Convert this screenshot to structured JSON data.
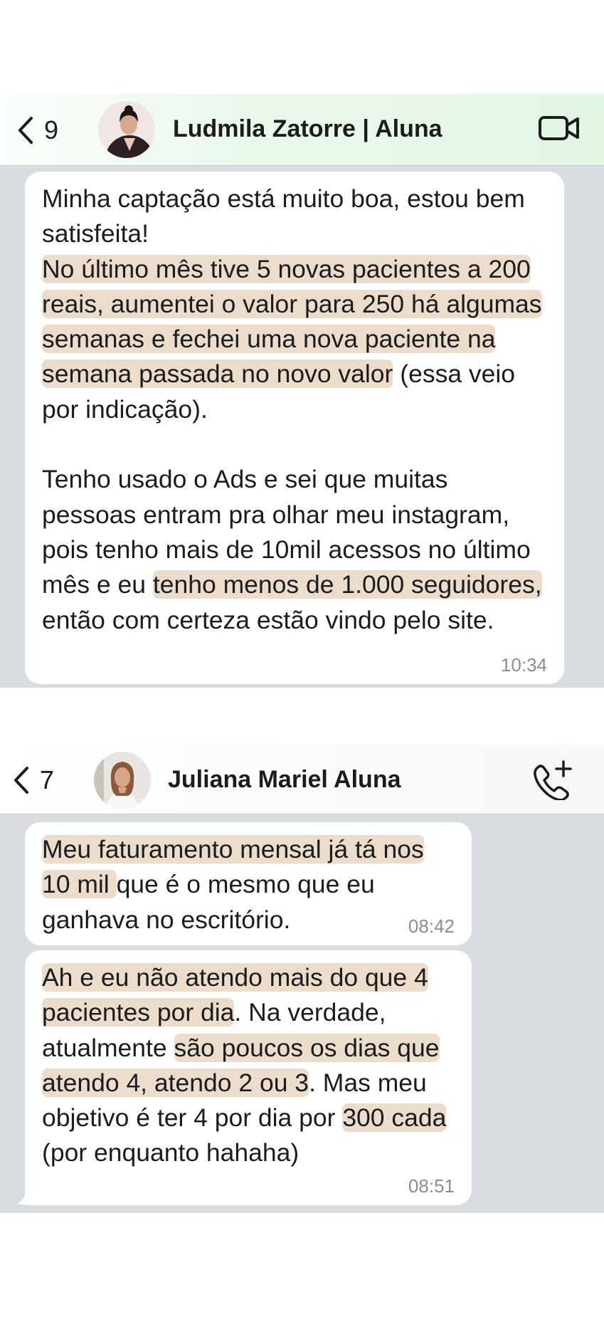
{
  "chat1": {
    "back_count": "9",
    "contact_name": "Ludmila Zatorre | Aluna",
    "action_icon": "video-camera-icon",
    "message": {
      "segments": [
        {
          "text": "Minha captação está muito boa, estou bem satisfeita!",
          "highlight": false,
          "br_after": true
        },
        {
          "text": "No último mês tive 5 novas pacientes a 200 reais, aumentei o valor para 250 há algumas semanas e fechei uma nova paciente na semana passada no novo valor",
          "highlight": true
        },
        {
          "text": " (essa veio por indicação).",
          "highlight": false,
          "br_after": true,
          "blank_after": true
        },
        {
          "text": "Tenho usado o Ads e sei que muitas pessoas entram pra olhar meu instagram, pois tenho mais de 10mil acessos no último mês e eu ",
          "highlight": false
        },
        {
          "text": "tenho menos de 1.000 seguidores,",
          "highlight": true
        },
        {
          "text": " então com certeza estão vindo pelo site.",
          "highlight": false
        }
      ],
      "time": "10:34"
    }
  },
  "chat2": {
    "back_count": "7",
    "contact_name": "Juliana Mariel Aluna",
    "action_icon": "phone-add-icon",
    "messages": [
      {
        "segments": [
          {
            "text": "Meu faturamento mensal já tá nos 10 mil ",
            "highlight": true
          },
          {
            "text": "que é o mesmo que eu ganhava no escritório.",
            "highlight": false
          }
        ],
        "time": "08:42"
      },
      {
        "segments": [
          {
            "text": "Ah e eu não atendo mais do que 4 pacientes por dia",
            "highlight": true
          },
          {
            "text": ". Na verdade, atualmente ",
            "highlight": false
          },
          {
            "text": "são poucos os dias que atendo 4, atendo 2 ou 3",
            "highlight": true
          },
          {
            "text": ". Mas meu objetivo é ter 4 por dia por ",
            "highlight": false
          },
          {
            "text": "300 cada",
            "highlight": true
          },
          {
            "text": " (por enquanto hahaha)",
            "highlight": false
          }
        ],
        "time": "08:51"
      }
    ]
  },
  "colors": {
    "header_green": "#e2f6e4",
    "chat_background": "#d9dce0",
    "bubble": "#ffffff",
    "highlight": "#ecdccc",
    "timestamp": "#8b8e91"
  }
}
